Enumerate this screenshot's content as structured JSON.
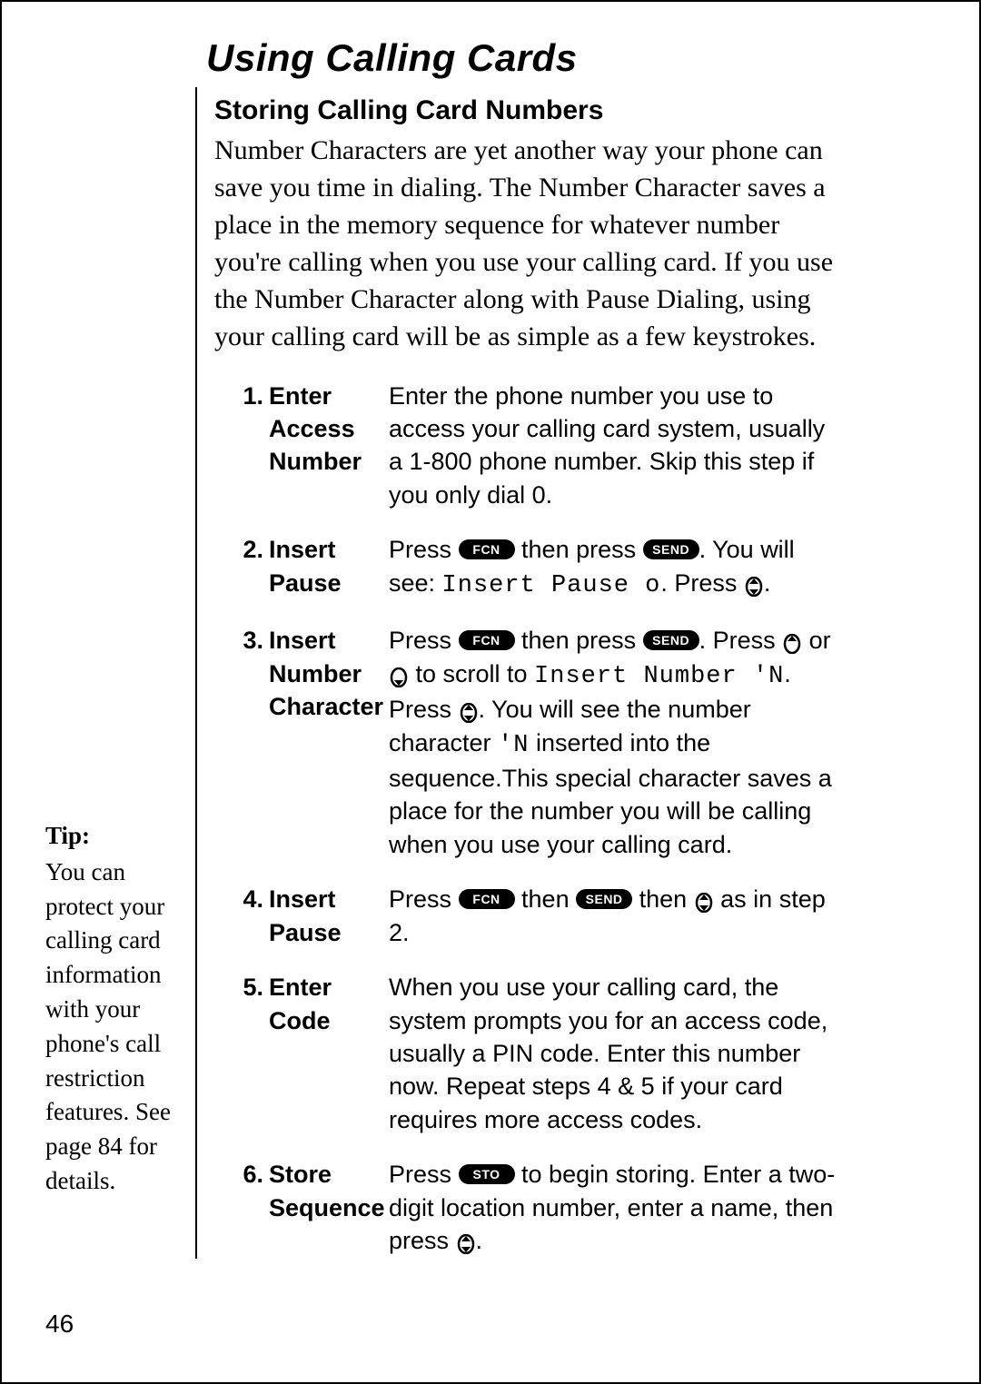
{
  "title": "Using Calling Cards",
  "section_heading": "Storing Calling Card Numbers",
  "intro": "Number Characters are yet another way your phone can save you time in dialing. The Number Character saves a place in the memory sequence for whatever number you're calling when you use your calling card. If you use the Number Character along with Pause Dialing, using your calling card will be as simple as a few keystrokes.",
  "buttons": {
    "fcn": "FCN",
    "send": "SEND",
    "sto": "STO"
  },
  "display": {
    "insert_pause": "Insert Pause o",
    "insert_number": "Insert Number 'N",
    "char_n": "'N"
  },
  "steps": {
    "s1": {
      "num": "1.",
      "label": "Enter Access Number",
      "desc": "Enter the phone number you use to access your calling card system, usually a 1-800 phone number. Skip this step if you only dial 0."
    },
    "s2": {
      "num": "2.",
      "label": "Insert Pause",
      "pre": "Press ",
      "mid1": " then press ",
      "post1": ". You will see: ",
      "post2": ". Press ",
      "post3": "."
    },
    "s3": {
      "num": "3.",
      "label": "Insert Number Character",
      "a": "Press ",
      "b": " then press ",
      "c": ". Press ",
      "d": " or ",
      "e": " to scroll to ",
      "f": ". Press ",
      "g": ". You will see the number character ",
      "h": " inserted into the sequence.This special character saves a place for the number you will be calling when you use your calling card."
    },
    "s4": {
      "num": "4.",
      "label": "Insert Pause",
      "a": "Press ",
      "b": " then ",
      "c": " then ",
      "d": " as in step 2."
    },
    "s5": {
      "num": "5.",
      "label": "Enter Code",
      "desc": "When you use your calling card, the system prompts you for an access code, usually a PIN code. Enter this number now. Repeat steps 4 & 5 if your card requires more access codes."
    },
    "s6": {
      "num": "6.",
      "label": "Store Sequence",
      "a": "Press ",
      "b": " to begin storing. Enter a two-digit location number, enter a name, then press ",
      "c": "."
    }
  },
  "tip": {
    "heading": "Tip:",
    "body": "You can protect your calling card information with your phone's call restriction features. See page 84 for details."
  },
  "page_number": "46"
}
